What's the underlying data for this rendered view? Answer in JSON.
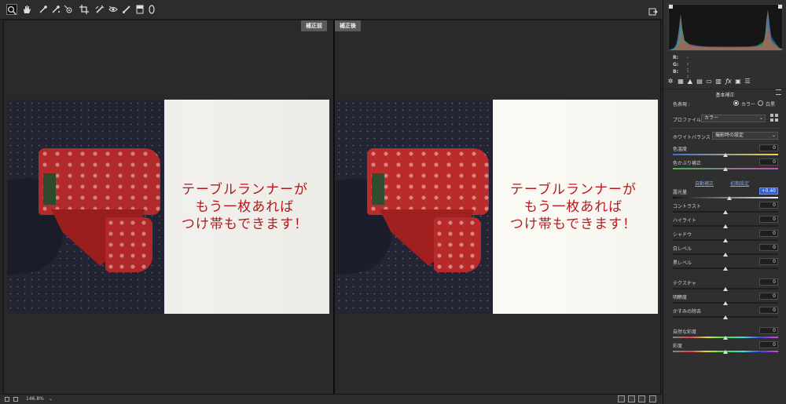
{
  "toolbar": {
    "tools": [
      {
        "name": "zoom-tool",
        "icon": "magnifier-icon",
        "glyph": "🔍"
      },
      {
        "name": "hand-tool",
        "icon": "hand-icon",
        "glyph": "✋"
      },
      {
        "name": "white-balance-tool",
        "icon": "eyedropper-icon",
        "glyph": "✒"
      },
      {
        "name": "color-sampler-tool",
        "icon": "sampler-icon",
        "glyph": "✐"
      },
      {
        "name": "targeted-adjustment-tool",
        "icon": "target-icon",
        "glyph": "◎"
      },
      {
        "name": "crop-tool",
        "icon": "crop-icon",
        "glyph": "⌗"
      },
      {
        "name": "spot-removal-tool",
        "icon": "brush-heal-icon",
        "glyph": "✎"
      },
      {
        "name": "red-eye-tool",
        "icon": "eye-icon",
        "glyph": "◉"
      },
      {
        "name": "adjustment-brush-tool",
        "icon": "brush-icon",
        "glyph": "✏"
      },
      {
        "name": "graduated-filter-tool",
        "icon": "gradient-icon",
        "glyph": "▤"
      },
      {
        "name": "radial-filter-tool",
        "icon": "ellipse-icon",
        "glyph": "◯"
      }
    ]
  },
  "canvas": {
    "before_label": "補正前",
    "after_label": "補正後",
    "caption": "テーブルランナーが\nもう一枚あれば\nつけ帯もできます！"
  },
  "status": {
    "zoom": "146.8%"
  },
  "panel": {
    "rgb": [
      {
        "label": "R:",
        "value": "---"
      },
      {
        "label": "G:",
        "value": "---"
      },
      {
        "label": "B:",
        "value": "---"
      }
    ],
    "section_title": "基本補正",
    "color_mode_label": "色表現 :",
    "color_option": "カラー",
    "bw_option": "白黒",
    "profile_label": "プロファイル :",
    "profile_value": "カラー",
    "wb_label": "ホワイトバランス :",
    "wb_value": "撮影時の設定",
    "auto_link": "自動補正",
    "default_link": "初期設定",
    "sliders": [
      {
        "label": "色温度",
        "value": "0",
        "level": 0.5
      },
      {
        "label": "色かぶり補正",
        "value": "0",
        "level": 0.5
      },
      {
        "label": "露光量",
        "value": "+0.40",
        "level": 0.54,
        "selected": true
      },
      {
        "label": "コントラスト",
        "value": "0",
        "level": 0.5
      },
      {
        "label": "ハイライト",
        "value": "0",
        "level": 0.5
      },
      {
        "label": "シャドウ",
        "value": "0",
        "level": 0.5
      },
      {
        "label": "白レベル",
        "value": "0",
        "level": 0.5
      },
      {
        "label": "黒レベル",
        "value": "0",
        "level": 0.5
      },
      {
        "label": "テクスチャ",
        "value": "0",
        "level": 0.5
      },
      {
        "label": "明瞭度",
        "value": "0",
        "level": 0.5
      },
      {
        "label": "かすみの除去",
        "value": "0",
        "level": 0.5
      },
      {
        "label": "自然な彩度",
        "value": "0",
        "level": 0.5
      },
      {
        "label": "彩度",
        "value": "0",
        "level": 0.5
      }
    ]
  }
}
